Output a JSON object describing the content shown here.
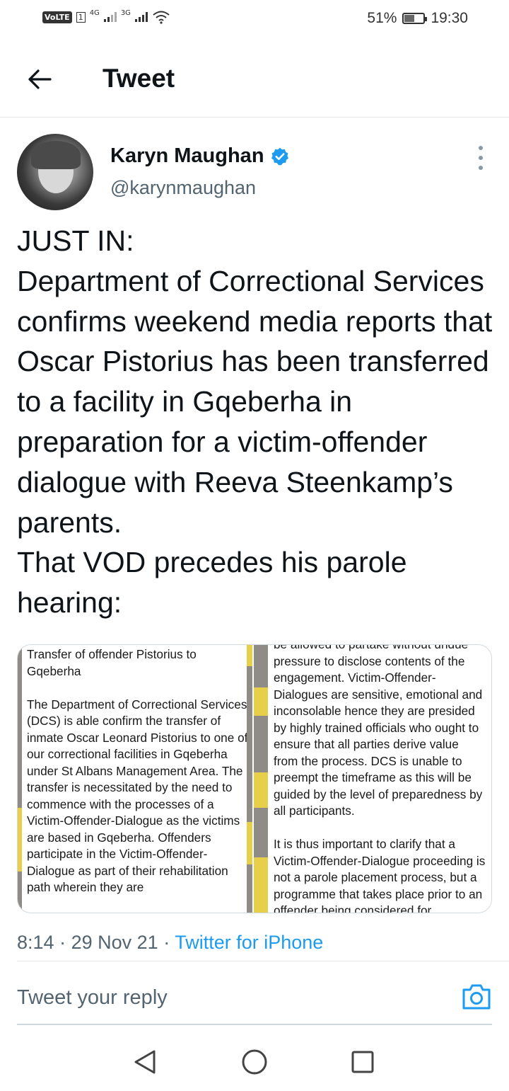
{
  "status_bar": {
    "volte": "VoLTE",
    "sim": "1",
    "net1": "4G",
    "net2": "3G",
    "battery_pct": "51%",
    "battery_level": 0.51,
    "time": "19:30"
  },
  "header": {
    "title": "Tweet",
    "back_icon": "arrow-left-icon"
  },
  "tweet": {
    "author_name": "Karyn Maughan",
    "author_handle": "@karynmaughan",
    "verified_icon": "verified-badge-icon",
    "more_icon": "more-vertical-icon",
    "text": "JUST IN:\nDepartment of Correctional Services confirms weekend media reports that Oscar Pistorius has been transferred to a facility in Gqeberha in preparation for a victim-offender dialogue with Reeva Steenkamp’s parents.\nThat VOD precedes his parole hearing:",
    "media": {
      "left_text": "Transfer of offender Pistorius to Gqeberha\n\nThe Department of Correctional Services (DCS) is able confirm the transfer of inmate Oscar Leonard Pistorius to one of our correctional facilities in Gqeberha under St Albans Management Area.  The transfer is necessitated by the need to commence with the processes of a Victim-Offender-Dialogue as the victims are based in Gqeberha. Offenders participate in the Victim-Offender-Dialogue as part of their rehabilitation path wherein they are",
      "right_text": "be allowed to partake without undue pressure to disclose contents of the engagement. Victim-Offender-Dialogues are sensitive, emotional and inconsolable hence they are presided by highly trained officials who ought to ensure that all parties derive value from the process.  DCS is unable to preempt the timeframe as this will be guided by the level of preparedness by all participants.\n\nIt is thus important to clarify that a Victim-Offender-Dialogue proceeding is not a parole placement process, but a programme that takes place prior to an offender being considered for"
    },
    "time": "8:14",
    "date": "29 Nov 21",
    "source": "Twitter for iPhone",
    "sep": "·"
  },
  "reply": {
    "placeholder": "Tweet your reply",
    "camera_icon": "camera-icon"
  },
  "nav": {
    "back_icon": "nav-back-icon",
    "home_icon": "nav-home-icon",
    "recents_icon": "nav-recents-icon"
  },
  "colors": {
    "accent": "#1d9bf0",
    "text": "#0f1419",
    "secondary": "#536471",
    "border": "#e6e9ec"
  }
}
